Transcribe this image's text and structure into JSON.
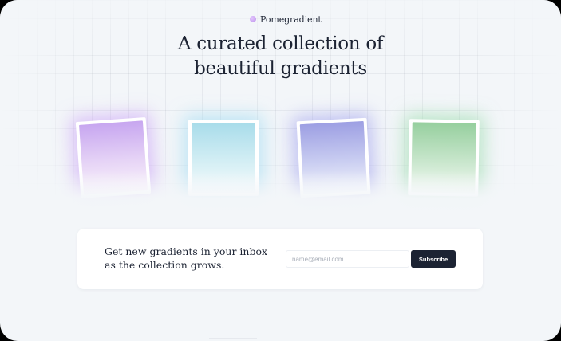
{
  "brand": {
    "name": "Pomegradient",
    "logo_icon": "pomegranate-dot-icon",
    "logo_color": "#c9a3f0"
  },
  "hero": {
    "headline_line1": "A curated collection of",
    "headline_line2": "beautiful gradients"
  },
  "gradients": [
    {
      "name": "purple-gradient",
      "colors": [
        "#c7a6f0",
        "#fbf4fb"
      ]
    },
    {
      "name": "cyan-gradient",
      "colors": [
        "#a8dcea",
        "#f6fbfc"
      ]
    },
    {
      "name": "indigo-gradient",
      "colors": [
        "#9d9fe3",
        "#f4f6fc"
      ]
    },
    {
      "name": "green-gradient",
      "colors": [
        "#96cf9e",
        "#f4faf4"
      ]
    }
  ],
  "newsletter": {
    "text_line1": "Get new gradients in your inbox",
    "text_line2": "as the collection grows.",
    "email_placeholder": "name@email.com",
    "email_value": "",
    "subscribe_label": "Subscribe",
    "button_color": "#1c2333"
  }
}
